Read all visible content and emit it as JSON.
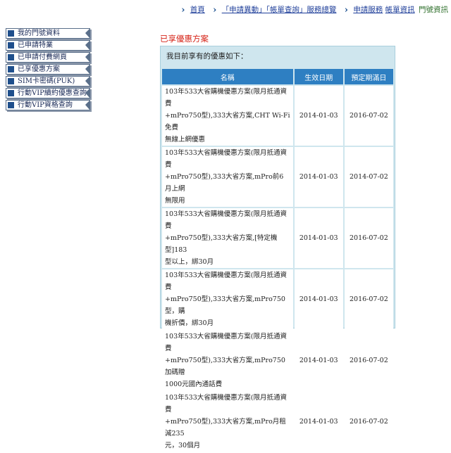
{
  "breadcrumb": {
    "home": "首頁",
    "apply_service": "「申請異動」「帳單查詢」服務總覽",
    "service": "申請服務",
    "account_info": "帳單資訊",
    "current": "門號資訊"
  },
  "sidebar": {
    "items": [
      {
        "label": "我的門號資料"
      },
      {
        "label": "已申請特業"
      },
      {
        "label": "已申請付費網頁"
      },
      {
        "label": "已享優惠方案"
      },
      {
        "label": "SIM卡密碼(PUK)"
      },
      {
        "label": "行動VIP續約優惠查詢"
      },
      {
        "label": "行動VIP資格查詢"
      }
    ]
  },
  "main": {
    "section_title": "已享優惠方案",
    "intro": "我目前享有的優惠如下：",
    "columns": {
      "name": "名稱",
      "start": "生效日期",
      "end": "預定期滿日"
    },
    "rows": [
      {
        "l1": "103年533大省購機優惠方案(限月抵通資費",
        "l2": "+mPro750型),333大省方案,CHT Wi-Fi免費",
        "l3": "無線上網優惠",
        "start": "2014-01-03",
        "end": "2016-07-02"
      },
      {
        "l1": "103年533大省購機優惠方案(限月抵通資費",
        "l2": "+mPro750型),333大省方案,mPro前6月上網",
        "l3": "無限用",
        "start": "2014-01-03",
        "end": "2014-07-02"
      },
      {
        "l1": "103年533大省購機優惠方案(限月抵通資費",
        "l2": "+mPro750型),333大省方案,[特定機型]183",
        "l3": "型以上，綁30月",
        "start": "2014-01-03",
        "end": "2016-07-02"
      },
      {
        "l1": "103年533大省購機優惠方案(限月抵通資費",
        "l2": "+mPro750型),333大省方案,mPro750型，購",
        "l3": "機折價，綁30月",
        "start": "2014-01-03",
        "end": "2016-07-02"
      },
      {
        "l1": "103年533大省購機優惠方案(限月抵通資費",
        "l2": "+mPro750型),333大省方案,mPro750加碼贈",
        "l3": "1000元國內通話費",
        "start": "2014-01-03",
        "end": "2016-07-02"
      },
      {
        "l1": "103年533大省購機優惠方案(限月抵通資費",
        "l2": "+mPro750型),333大省方案,mPro月租減235",
        "l3": "元，30個月",
        "start": "2014-01-03",
        "end": "2016-07-02"
      }
    ]
  }
}
